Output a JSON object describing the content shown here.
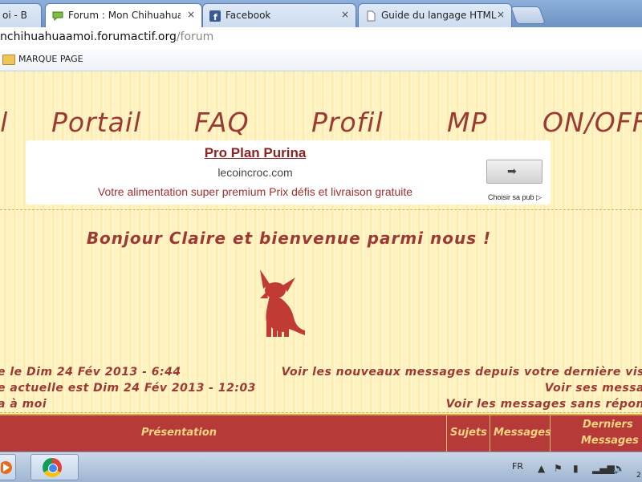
{
  "browser": {
    "tabs": [
      {
        "label": "oi - B",
        "active": false,
        "icon": "forum-icon"
      },
      {
        "label": "Forum : Mon Chihuahua à",
        "active": true,
        "icon": "chat-bubble-icon"
      },
      {
        "label": "Facebook",
        "active": false,
        "icon": "facebook-icon"
      },
      {
        "label": "Guide du langage HTML",
        "active": false,
        "icon": "page-icon"
      }
    ],
    "close_glyph": "×",
    "url": {
      "host": "nchihuahuaamoi.forumactif.org",
      "path": "/forum"
    },
    "bookmark_folder": "MARQUE PAGE"
  },
  "nav": {
    "items": [
      "il",
      "Portail",
      "FAQ",
      "Profil",
      "MP",
      "ON/OFF"
    ]
  },
  "ad": {
    "title": "Pro Plan Purina",
    "domain": "lecoincroc.com",
    "description": "Votre alimentation super premium Prix défis et livraison gratuite",
    "button_arrow": "➡",
    "choice_label": "Choisir sa pub ▷"
  },
  "welcome": "Bonjour Claire et bienvenue parmi nous !",
  "info": {
    "left": [
      "e le Dim 24 Fév 2013 - 6:44",
      "e actuelle est Dim 24 Fév 2013 - 12:03",
      "a à moi"
    ],
    "right": [
      "Voir les nouveaux messages depuis votre dernière vis",
      "Voir ses messa",
      "Voir les messages sans répon"
    ]
  },
  "category_header": {
    "presentation": "Présentation",
    "sujets": "Sujets",
    "messages": "Messages",
    "derniers_messages_1": "Derniers",
    "derniers_messages_2": "Messages"
  },
  "taskbar": {
    "language": "FR",
    "clock": "2"
  },
  "colors": {
    "accent_red": "#9b3a33",
    "category_bar": "#b63a37",
    "category_text": "#f4d483",
    "page_bg": "#fff3c2"
  }
}
